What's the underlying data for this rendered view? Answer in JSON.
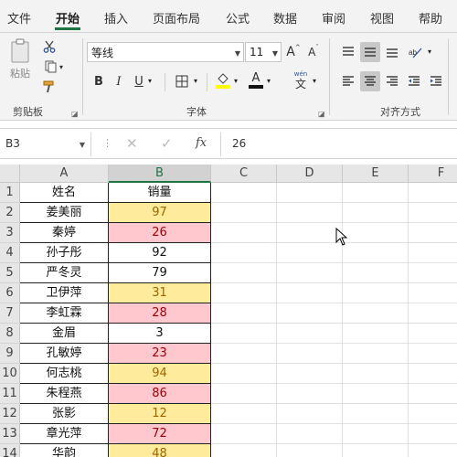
{
  "menu": {
    "items": [
      "文件",
      "开始",
      "插入",
      "页面布局",
      "公式",
      "数据",
      "审阅",
      "视图",
      "帮助"
    ]
  },
  "ribbon": {
    "clipboard": {
      "paste_label": "粘贴",
      "group_label": "剪贴板"
    },
    "font": {
      "font_name": "等线",
      "font_size": "11",
      "bold": "B",
      "italic": "I",
      "underline": "U",
      "grow": "A",
      "shrink": "A",
      "phonetic_top": "wén",
      "group_label": "字体"
    },
    "alignment": {
      "group_label": "对齐方式"
    }
  },
  "formula_bar": {
    "name_box": "B3",
    "value": "26"
  },
  "sheet": {
    "columns": [
      "A",
      "B",
      "C",
      "D",
      "E",
      "F"
    ],
    "rows": [
      {
        "num": "1",
        "name": "姓名",
        "value": "销量",
        "style": "plain"
      },
      {
        "num": "2",
        "name": "姜美丽",
        "value": "97",
        "style": "yellow"
      },
      {
        "num": "3",
        "name": "秦婷",
        "value": "26",
        "style": "pink"
      },
      {
        "num": "4",
        "name": "孙子彤",
        "value": "92",
        "style": "plain"
      },
      {
        "num": "5",
        "name": "严冬灵",
        "value": "79",
        "style": "plain"
      },
      {
        "num": "6",
        "name": "卫伊萍",
        "value": "31",
        "style": "yellow"
      },
      {
        "num": "7",
        "name": "李虹霖",
        "value": "28",
        "style": "pink"
      },
      {
        "num": "8",
        "name": "金眉",
        "value": "3",
        "style": "plain"
      },
      {
        "num": "9",
        "name": "孔敏婷",
        "value": "23",
        "style": "pink"
      },
      {
        "num": "10",
        "name": "何志桃",
        "value": "94",
        "style": "yellow"
      },
      {
        "num": "11",
        "name": "朱程燕",
        "value": "86",
        "style": "pink"
      },
      {
        "num": "12",
        "name": "张影",
        "value": "12",
        "style": "yellow"
      },
      {
        "num": "13",
        "name": "章光萍",
        "value": "72",
        "style": "pink"
      },
      {
        "num": "14",
        "name": "华韵",
        "value": "48",
        "style": "yellow"
      }
    ]
  },
  "colors": {
    "accent": "#217346",
    "yellow_fill": "#ffeb9c",
    "yellow_text": "#9c6500",
    "pink_fill": "#ffc7ce",
    "pink_text": "#9c0006"
  }
}
